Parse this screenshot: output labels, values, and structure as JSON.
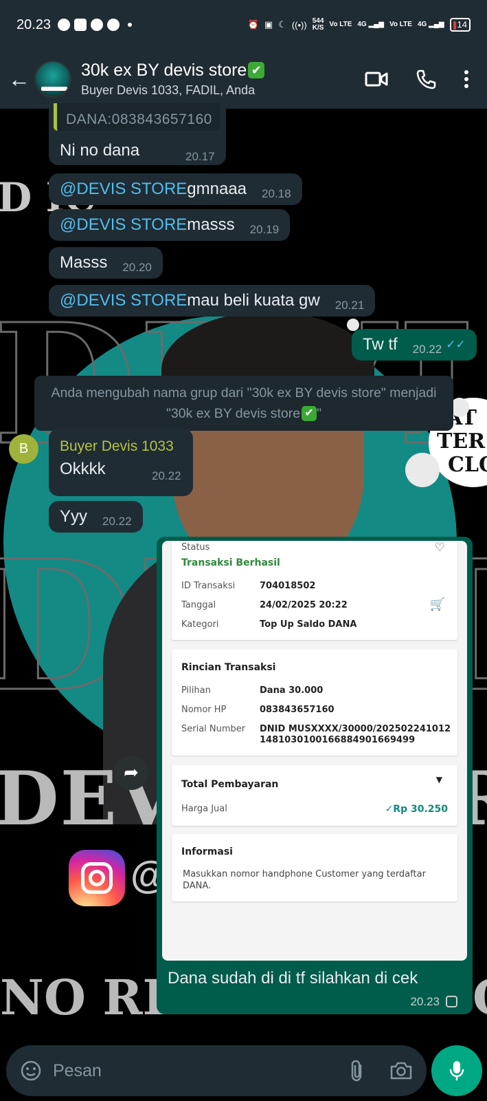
{
  "status_bar": {
    "time": "20.23",
    "net_speed": "544",
    "net_unit": "K/S",
    "vo_lte_1": "Vo LTE",
    "g4_1": "4G",
    "vo_lte_2": "Vo LTE",
    "g4_2": "4G",
    "battery": "14"
  },
  "header": {
    "title": "30k ex BY devis store",
    "title_emoji": "✔",
    "subtitle": "Buyer Devis 1033, FADIL, Anda"
  },
  "messages": {
    "quoted": {
      "text": "DANA:083843657160",
      "body": "Ni no dana",
      "time": "20.17"
    },
    "m1": {
      "mention": "@DEVIS STORE",
      "text": " gmnaaa",
      "time": "20.18"
    },
    "m2": {
      "mention": "@DEVIS STORE",
      "text": " masss",
      "time": "20.19"
    },
    "m3": {
      "text": "Masss",
      "time": "20.20"
    },
    "m4": {
      "mention": "@DEVIS STORE",
      "text": " mau beli kuata gw",
      "time": "20.21"
    },
    "out1": {
      "text": "Tw tf",
      "time": "20.22",
      "status": "read"
    },
    "system": {
      "line1": "Anda mengubah nama grup dari \"30k ex BY devis store\" menjadi",
      "line2": "\"30k ex BY devis store",
      "line2_end": "\""
    },
    "buyer": {
      "avatar_letter": "B",
      "name": "Buyer Devis 1033",
      "msg1": "Okkkk",
      "time1": "20.22",
      "msg2": "Yyy",
      "time2": "20.22"
    },
    "image_msg": {
      "caption": "Dana sudah di di tf silahkan di cek",
      "time": "20.23",
      "receipt": {
        "status_label": "Status",
        "status_value": "Transaksi Berhasil",
        "id_label": "ID Transaksi",
        "id_value": "704018502",
        "date_label": "Tanggal",
        "date_value": "24/02/2025 20:22",
        "cat_label": "Kategori",
        "cat_value": "Top Up Saldo DANA",
        "detail_title": "Rincian Transaksi",
        "option_label": "Pilihan",
        "option_value": "Dana 30.000",
        "phone_label": "Nomor HP",
        "phone_value": "083843657160",
        "serial_label": "Serial Number",
        "serial_value_1": "DNID MUSXXXX/30000/202502241012",
        "serial_value_2": "14810301001668849016694​99",
        "total_title": "Total Pembayaran",
        "price_label": "Harga Jual",
        "price_value": "Rp 30.250",
        "info_title": "Informasi",
        "info_text": "Masukkan nomor handphone Customer yang terdaftar DANA."
      }
    }
  },
  "wallpaper": {
    "line_top": "D IC",
    "line_devt": "DEVT",
    "line_devt_r": "R",
    "line_noreal": "NO REA",
    "line_noreal_r": "G",
    "badge_1": "IAT",
    "badge_2": "TER",
    "badge_3": "CLO",
    "at_sign": "@"
  },
  "input": {
    "placeholder": "Pesan"
  },
  "colors": {
    "header_bg": "#202c33",
    "incoming_bubble": "#1f2c34",
    "outgoing_bubble": "#005c4b",
    "mention": "#53bdeb",
    "accent": "#00a884"
  }
}
